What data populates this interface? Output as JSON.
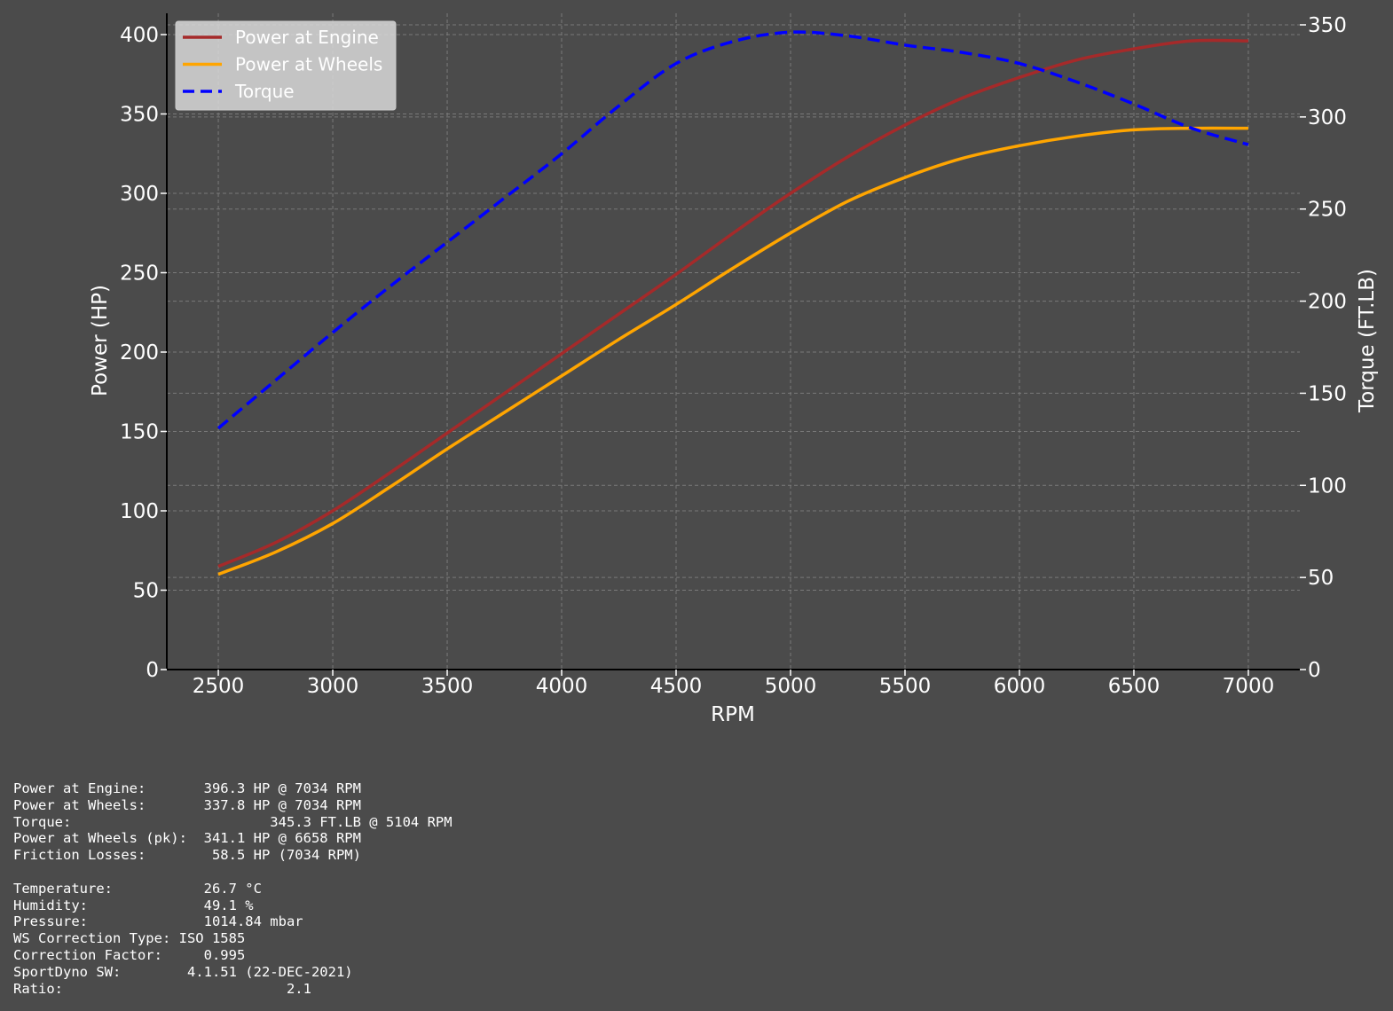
{
  "colors": {
    "background": "#4b4b4b",
    "engine": "#a52a2a",
    "wheels": "#ffa500",
    "torque": "#0000ff",
    "grid": "#7a7a7a",
    "axis": "#000000",
    "text": "#ffffff",
    "legend_bg": "#d9d9d9"
  },
  "chart_data": {
    "type": "line",
    "xlabel": "RPM",
    "ylabel": "Power (HP)",
    "y2label": "Torque (FT.LB)",
    "xlim": [
      2275,
      7225
    ],
    "ylim": [
      0,
      400
    ],
    "y2lim": [
      0,
      350
    ],
    "x_ticks": [
      2500,
      3000,
      3500,
      4000,
      4500,
      5000,
      5500,
      6000,
      6500,
      7000
    ],
    "y_ticks": [
      0,
      50,
      100,
      150,
      200,
      250,
      300,
      350,
      400
    ],
    "y2_ticks": [
      0,
      50,
      100,
      150,
      200,
      250,
      300,
      350
    ],
    "grid": true,
    "legend_position": "top-left",
    "x": [
      2500,
      2750,
      3000,
      3250,
      3500,
      3750,
      4000,
      4250,
      4500,
      4750,
      5000,
      5250,
      5500,
      5750,
      6000,
      6250,
      6500,
      6750,
      7000
    ],
    "series": [
      {
        "name": "Power at Engine",
        "axis": "left",
        "style": "solid",
        "color": "#a52a2a",
        "values": [
          65,
          80,
          100,
          124,
          149,
          174,
          199,
          224,
          249,
          275,
          300,
          323,
          343,
          360,
          373,
          384,
          391,
          396,
          396
        ]
      },
      {
        "name": "Power at Wheels",
        "axis": "left",
        "style": "solid",
        "color": "#ffa500",
        "values": [
          60,
          74,
          92,
          115,
          139,
          162,
          185,
          208,
          230,
          253,
          275,
          295,
          310,
          322,
          330,
          336,
          340,
          341,
          341
        ]
      },
      {
        "name": "Torque",
        "axis": "right",
        "style": "dashed",
        "color": "#0000ff",
        "values": [
          131,
          157,
          183,
          208,
          232,
          256,
          280,
          306,
          329,
          341,
          346,
          344,
          339,
          335,
          329,
          319,
          307,
          294,
          285
        ]
      }
    ]
  },
  "stats": [
    "Power at Engine:       396.3 HP @ 7034 RPM",
    "Power at Wheels:       337.8 HP @ 7034 RPM",
    "Torque:                        345.3 FT.LB @ 5104 RPM",
    "Power at Wheels (pk):  341.1 HP @ 6658 RPM",
    "Friction Losses:        58.5 HP (7034 RPM)",
    "",
    "Temperature:           26.7 °C",
    "Humidity:              49.1 %",
    "Pressure:              1014.84 mbar",
    "WS Correction Type: ISO 1585",
    "Correction Factor:     0.995",
    "SportDyno SW:        4.1.51 (22-DEC-2021)",
    "Ratio:                           2.1"
  ]
}
